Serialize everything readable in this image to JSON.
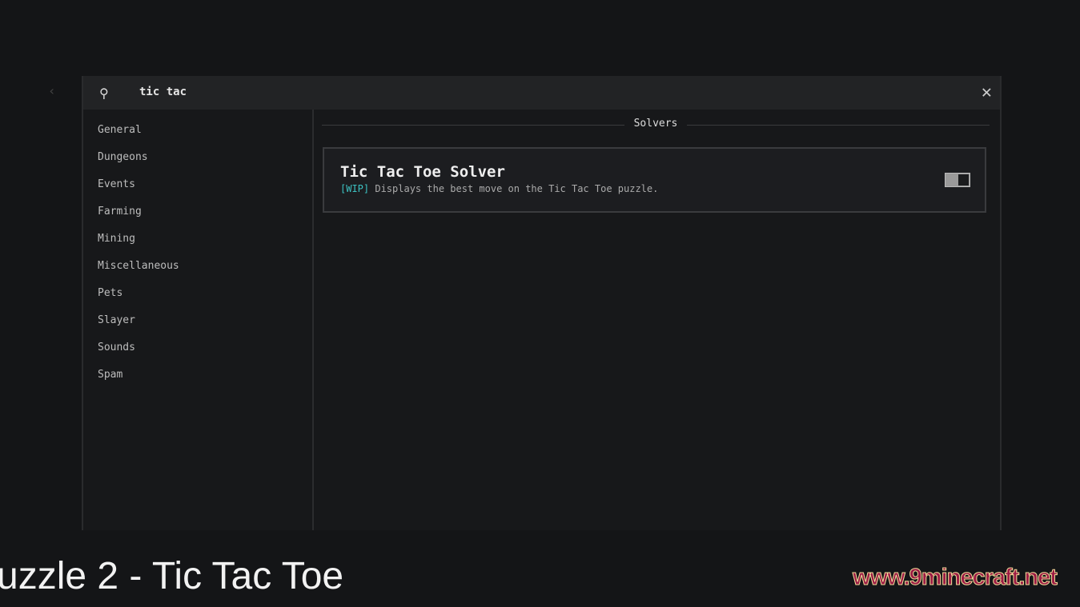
{
  "search": {
    "value": "tic tac",
    "icon": "search-icon"
  },
  "sidebar": {
    "items": [
      {
        "label": "General"
      },
      {
        "label": "Dungeons"
      },
      {
        "label": "Events"
      },
      {
        "label": "Farming"
      },
      {
        "label": "Mining"
      },
      {
        "label": "Miscellaneous"
      },
      {
        "label": "Pets"
      },
      {
        "label": "Slayer"
      },
      {
        "label": "Sounds"
      },
      {
        "label": "Spam"
      }
    ]
  },
  "main": {
    "section": "Solvers",
    "feature": {
      "title": "Tic Tac Toe Solver",
      "tag": "[WIP]",
      "description": " Displays the best move on the Tic Tac Toe puzzle.",
      "enabled": false
    }
  },
  "caption": "uzzle 2 - Tic Tac Toe",
  "watermark": "www.9minecraft.net",
  "colors": {
    "accent": "#3cc1c1",
    "watermark": "#9c1b45"
  }
}
